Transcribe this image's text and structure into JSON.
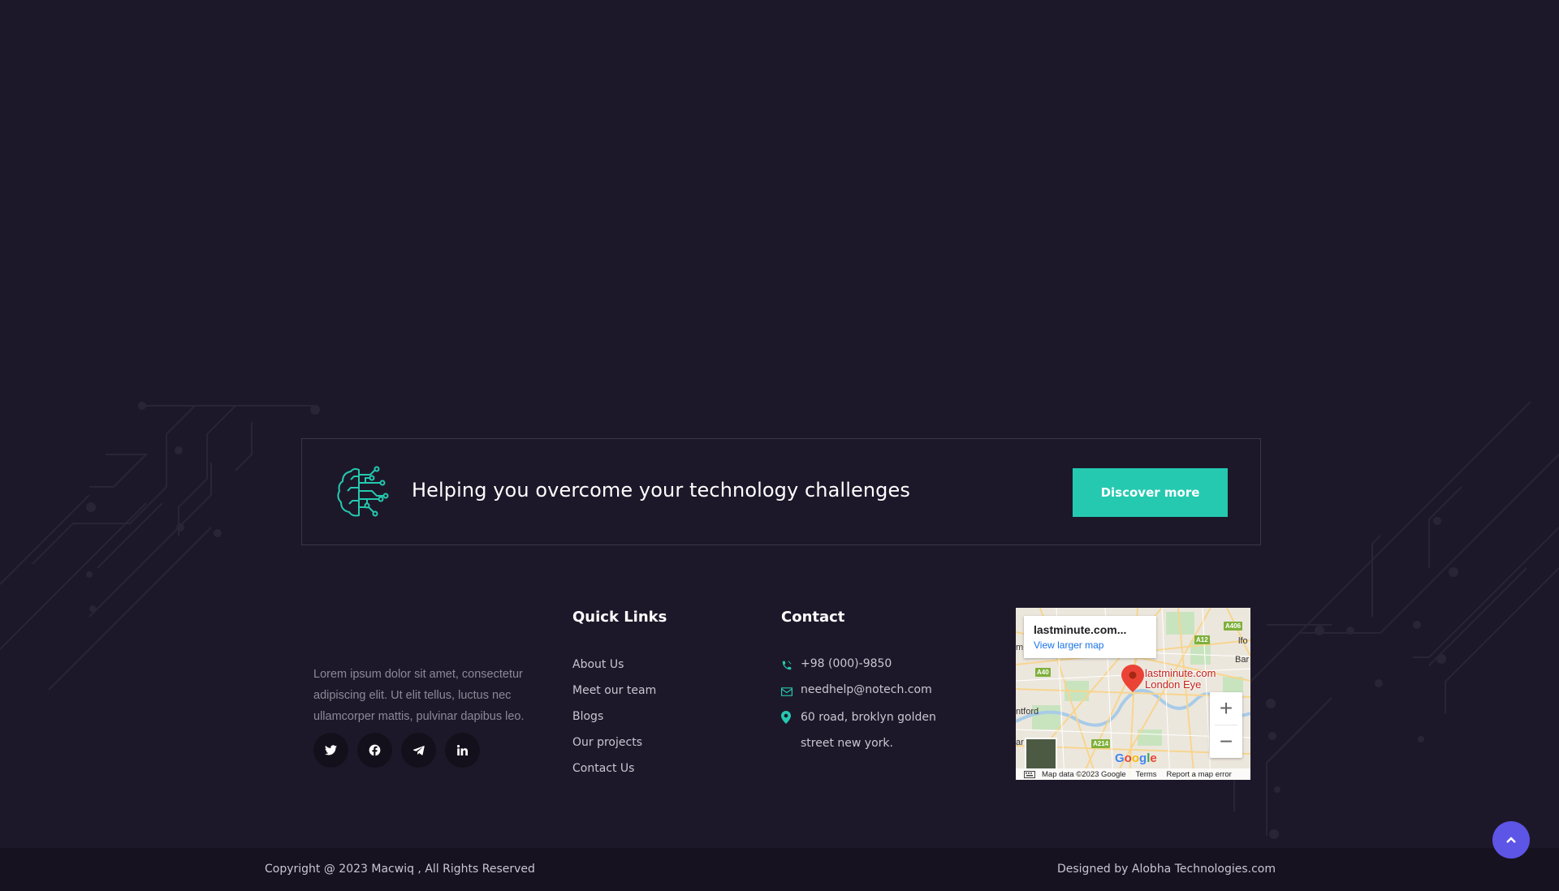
{
  "cta": {
    "text": "Helping you overcome your technology challenges",
    "button_label": "Discover more",
    "icon": "brain-circuit-icon"
  },
  "about": {
    "text": "Lorem ipsum dolor sit amet, consectetur adipiscing elit. Ut elit tellus, luctus nec ullamcorper mattis, pulvinar dapibus leo.",
    "socials": [
      {
        "name": "twitter-icon"
      },
      {
        "name": "facebook-icon"
      },
      {
        "name": "telegram-icon"
      },
      {
        "name": "linkedin-icon"
      }
    ]
  },
  "quick_links": {
    "title": "Quick Links",
    "items": [
      "About Us",
      "Meet our team",
      "Blogs",
      "Our projects",
      "Contact Us"
    ]
  },
  "contact": {
    "title": "Contact",
    "phone": "+98 (000)-9850",
    "email": "needhelp@notech.com",
    "address": "60 road, broklyn golden street new york."
  },
  "map": {
    "place_title": "lastminute.com...",
    "view_larger": "View larger map",
    "pin_label_line1": "lastminute.com",
    "pin_label_line2": "London Eye",
    "zoom_in": "+",
    "zoom_out": "−",
    "map_data": "Map data ©2023 Google",
    "terms": "Terms",
    "report": "Report a map error",
    "google": "Google",
    "road_labels": [
      "A406",
      "A12",
      "A40",
      "A214"
    ],
    "edge_labels": [
      "m",
      "lfo",
      "Bar",
      "ntford",
      "ar"
    ]
  },
  "footer": {
    "copyright": "Copyright @ 2023 Macwiq , All Rights Reserved",
    "designed_by": "Designed by Alobha Technologies.com"
  },
  "colors": {
    "background": "#1d1829",
    "accent": "#25c9b0",
    "scroll_top": "#5d55e6",
    "bottom_bar": "#16121f"
  }
}
